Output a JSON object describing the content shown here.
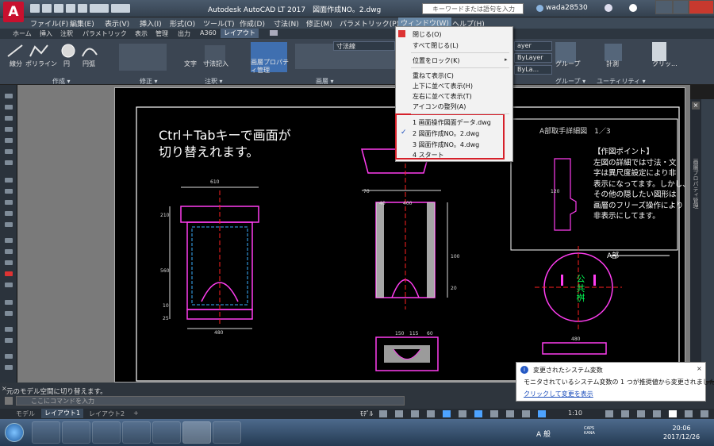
{
  "titlebar": {
    "app_title": "Autodesk AutoCAD LT 2017　図面作成NO。2.dwg",
    "search_placeholder": "キーワードまたは語句を入力",
    "user": "wada28530"
  },
  "menubar": [
    "ファイル(F)",
    "編集(E)",
    "表示(V)",
    "挿入(I)",
    "形式(O)",
    "ツール(T)",
    "作成(D)",
    "寸法(N)",
    "修正(M)",
    "パラメトリック(P)",
    "ウィンドウ(W)",
    "ヘルプ(H)"
  ],
  "ribbon_tabs": [
    "ホーム",
    "挿入",
    "注釈",
    "パラメトリック",
    "表示",
    "管理",
    "出力",
    "A360",
    "レイアウト"
  ],
  "ribbon": {
    "tools": [
      "線分",
      "ポリライン",
      "円",
      "円弧",
      "文字",
      "寸法記入",
      "画層プロパティ管理",
      "グループ",
      "計測",
      "クリッ..."
    ],
    "panels": [
      "作成 ▾",
      "修正 ▾",
      "注釈 ▾",
      "画層 ▾",
      "グループ ▾",
      "ユーティリティ ▾"
    ],
    "layer_name": "寸法線",
    "by_layer": "ByLayer",
    "by_layer2": "ByLa...",
    "layer_short": "ayer"
  },
  "dropdown": {
    "items": [
      "閉じる(O)",
      "すべて閉じる(L)",
      "位置をロック(K)",
      "重ねて表示(C)",
      "上下に並べて表示(H)",
      "左右に並べて表示(T)",
      "アイコンの整列(A)"
    ],
    "files": [
      "1 画面操作図面データ.dwg",
      "2 図面作成NO。2.dwg",
      "3 図面作成NO。4.dwg",
      "4 スタート"
    ],
    "checked_index": 1,
    "highlight_color": "#d6202a"
  },
  "drawing": {
    "instruction": "Ctrl＋Tabキーで画面が\n切り替えれます。",
    "detail_title": "A部取手詳細図　1／3",
    "point_text": "【作図ポイント】\n左図の詳細では寸法・文\n字は異尺度設定により非\n表示になってます。しかし、\nその他の隠したい図形は\n画層のフリーズ操作により\n非表示にしてます。",
    "a_part": "A部",
    "manhole_text": "公\n共\n桝",
    "dims": {
      "top": "610",
      "bottom": "480",
      "mid": "560",
      "d1": "210",
      "d2": "10",
      "d3": "25",
      "r1": "70",
      "r2": "400",
      "r3": "40",
      "r4": "120",
      "r5": "480",
      "r6": "115",
      "r7": "150",
      "r8": "60",
      "r9": "100",
      "r10": "20"
    }
  },
  "rightpanel_label": "画層プロパティ管理",
  "command": {
    "history": "元のモデル空間に切り替えます。",
    "placeholder": "ここにコマンドを入力"
  },
  "notification": {
    "title": "変更されたシステム変数",
    "body": "モニタされているシステム変数の 1 つが推奨値から変更されました",
    "link": "クリックして変更を表示"
  },
  "layout_tabs": [
    "モデル",
    "レイアウト1",
    "レイアウト2",
    "+"
  ],
  "status": {
    "space": "ﾓﾃﾞﾙ",
    "scale": "1:10"
  },
  "clock": {
    "time": "20:06",
    "date": "2017/12/26"
  },
  "tray": {
    "ime": "A 般",
    "caps": "CAPS KANA"
  }
}
